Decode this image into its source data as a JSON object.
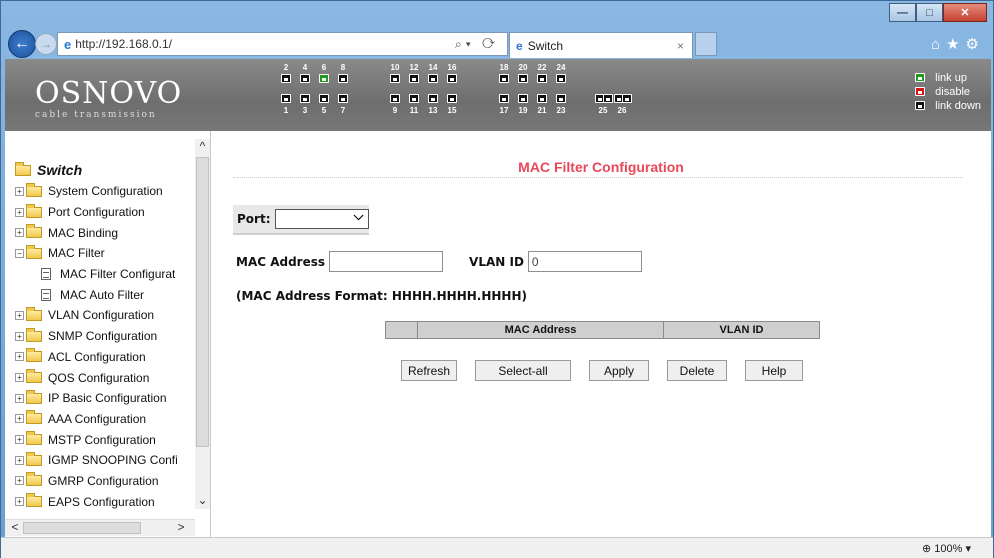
{
  "browser": {
    "url": "http://192.168.0.1/",
    "tab_title": "Switch",
    "tab_close": "×",
    "zoom": "100%"
  },
  "header": {
    "brand": "OSNOVO",
    "tagline": "cable transmission",
    "top_ports": [
      "2",
      "4",
      "6",
      "8",
      "10",
      "12",
      "14",
      "16",
      "18",
      "20",
      "22",
      "24"
    ],
    "bottom_ports": [
      "1",
      "3",
      "5",
      "7",
      "9",
      "11",
      "13",
      "15",
      "17",
      "19",
      "21",
      "23",
      "25",
      "26"
    ],
    "port_states": {
      "up": [
        "6"
      ]
    },
    "legend": [
      {
        "label": "link up",
        "color": "#1f9b1f"
      },
      {
        "label": "disable",
        "color": "#d21515"
      },
      {
        "label": "link down",
        "color": "#111111"
      }
    ]
  },
  "sidebar": {
    "root": "Switch",
    "items": [
      {
        "label": "System Configuration",
        "type": "folder"
      },
      {
        "label": "Port Configuration",
        "type": "folder"
      },
      {
        "label": "MAC Binding",
        "type": "folder"
      },
      {
        "label": "MAC Filter",
        "type": "folder-open"
      },
      {
        "label": "MAC Filter Configurat",
        "type": "page"
      },
      {
        "label": "MAC Auto Filter",
        "type": "page"
      },
      {
        "label": "VLAN Configuration",
        "type": "folder"
      },
      {
        "label": "SNMP Configuration",
        "type": "folder"
      },
      {
        "label": "ACL Configuration",
        "type": "folder"
      },
      {
        "label": "QOS Configuration",
        "type": "folder"
      },
      {
        "label": "IP Basic Configuration",
        "type": "folder"
      },
      {
        "label": "AAA Configuration",
        "type": "folder"
      },
      {
        "label": "MSTP Configuration",
        "type": "folder"
      },
      {
        "label": "IGMP SNOOPING Confi",
        "type": "folder"
      },
      {
        "label": "GMRP Configuration",
        "type": "folder"
      },
      {
        "label": "EAPS Configuration",
        "type": "folder"
      }
    ]
  },
  "main": {
    "title": "MAC Filter Configuration",
    "port_label": "Port:",
    "port_value": "",
    "mac_label": "MAC Address",
    "mac_value": "",
    "vlan_label": "VLAN ID",
    "vlan_value": "0",
    "format_note": "(MAC Address Format: HHHH.HHHH.HHHH)",
    "table_headers": [
      "",
      "MAC Address",
      "VLAN ID"
    ],
    "buttons": [
      "Refresh",
      "Select-all",
      "Apply",
      "Delete",
      "Help"
    ]
  },
  "colors": {
    "title": "#e8485a",
    "header_bg": "#7a7a7a",
    "table_header_bg": "#cfcfcf"
  }
}
